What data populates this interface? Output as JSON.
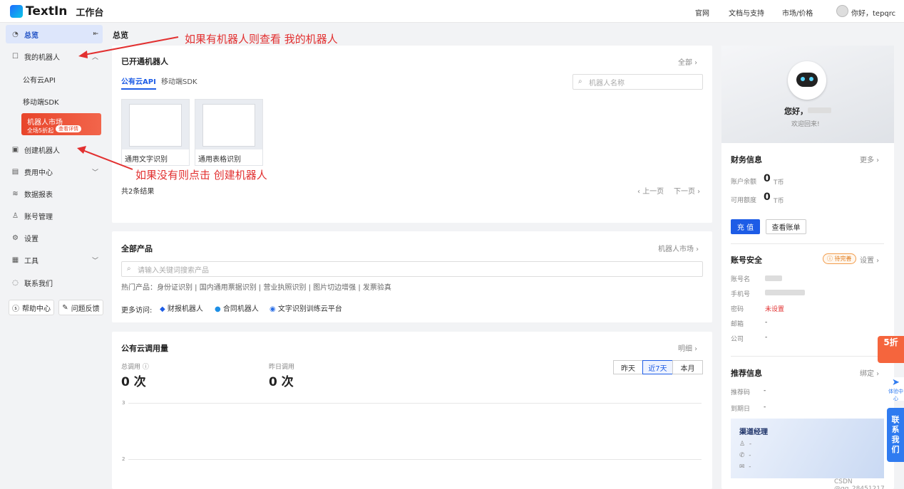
{
  "header": {
    "brand": "TextIn",
    "workspace": "工作台",
    "nav": [
      "官网",
      "文档与支持",
      "市场/价格"
    ],
    "greeting": "你好，tepqrc"
  },
  "sidebar": {
    "overview": "总览",
    "my_robots": "我的机器人",
    "sub_items": [
      "公有云API",
      "移动端SDK"
    ],
    "promo": {
      "title": "机器人市场",
      "subtitle": "全场5折起",
      "tag": "查看详情"
    },
    "create_robot": "创建机器人",
    "billing": "费用中心",
    "reports": "数据报表",
    "account": "账号管理",
    "settings": "设置",
    "tools": "工具",
    "contact": "联系我们",
    "help": "帮助中心",
    "feedback": "问题反馈"
  },
  "breadcrumb": "总览",
  "annotations": {
    "a1": "如果有机器人则查看 我的机器人",
    "a2": "如果没有则点击 创建机器人"
  },
  "opened": {
    "title": "已开通机器人",
    "all_link": "全部",
    "tabs": [
      "公有云API",
      "移动端SDK"
    ],
    "search_placeholder": "机器人名称",
    "robots": [
      "通用文字识别",
      "通用表格识别"
    ],
    "count": "共2条结果",
    "prev": "上一页",
    "next": "下一页"
  },
  "products": {
    "title": "全部产品",
    "market_link": "机器人市场",
    "search_placeholder": "请输入关键词搜索产品",
    "hot": "热门产品：身份证识别 | 国内通用票据识别 | 营业执照识别 | 图片切边增强 | 发票验真",
    "more_label": "更多访问:",
    "more_items": [
      "财报机器人",
      "合同机器人",
      "文字识别训练云平台"
    ]
  },
  "usage": {
    "title": "公有云调用量",
    "detail_link": "明细",
    "total_label": "总调用",
    "total_value": "0 次",
    "yesterday_label": "昨日调用",
    "yesterday_value": "0 次",
    "ranges": [
      "昨天",
      "近7天",
      "本月"
    ],
    "active_range": "近7天",
    "y_ticks": [
      "3",
      "2"
    ]
  },
  "profile": {
    "hello": "您好，",
    "welcome": "欢迎回来!"
  },
  "finance": {
    "title": "财务信息",
    "more": "更多",
    "balance_label": "账户余额",
    "balance": "0",
    "credit_label": "可用额度",
    "credit": "0",
    "unit": "T币",
    "recharge": "充 值",
    "bill": "查看账单"
  },
  "security": {
    "title": "账号安全",
    "badge": "待完善",
    "settings": "设置",
    "rows": [
      {
        "label": "账号名",
        "value": ""
      },
      {
        "label": "手机号",
        "value": ""
      },
      {
        "label": "密码",
        "value": "未设置"
      },
      {
        "label": "邮箱",
        "value": "-"
      },
      {
        "label": "公司",
        "value": "-"
      }
    ]
  },
  "referral": {
    "title": "推荐信息",
    "bind": "绑定",
    "rows": [
      {
        "label": "推荐码",
        "value": "-"
      },
      {
        "label": "到期日",
        "value": "-"
      }
    ],
    "manager_title": "渠道经理",
    "manager_rows": [
      "-",
      "-",
      "-"
    ]
  },
  "floating": {
    "sale": "5折",
    "contact": [
      "联",
      "系",
      "我",
      "们"
    ],
    "plane_label": "体验中心"
  },
  "watermark": "CSDN @qq_28451217",
  "colors": {
    "accent": "#1d5ce6",
    "annotation": "#e23030",
    "promo": "#e8452b"
  }
}
